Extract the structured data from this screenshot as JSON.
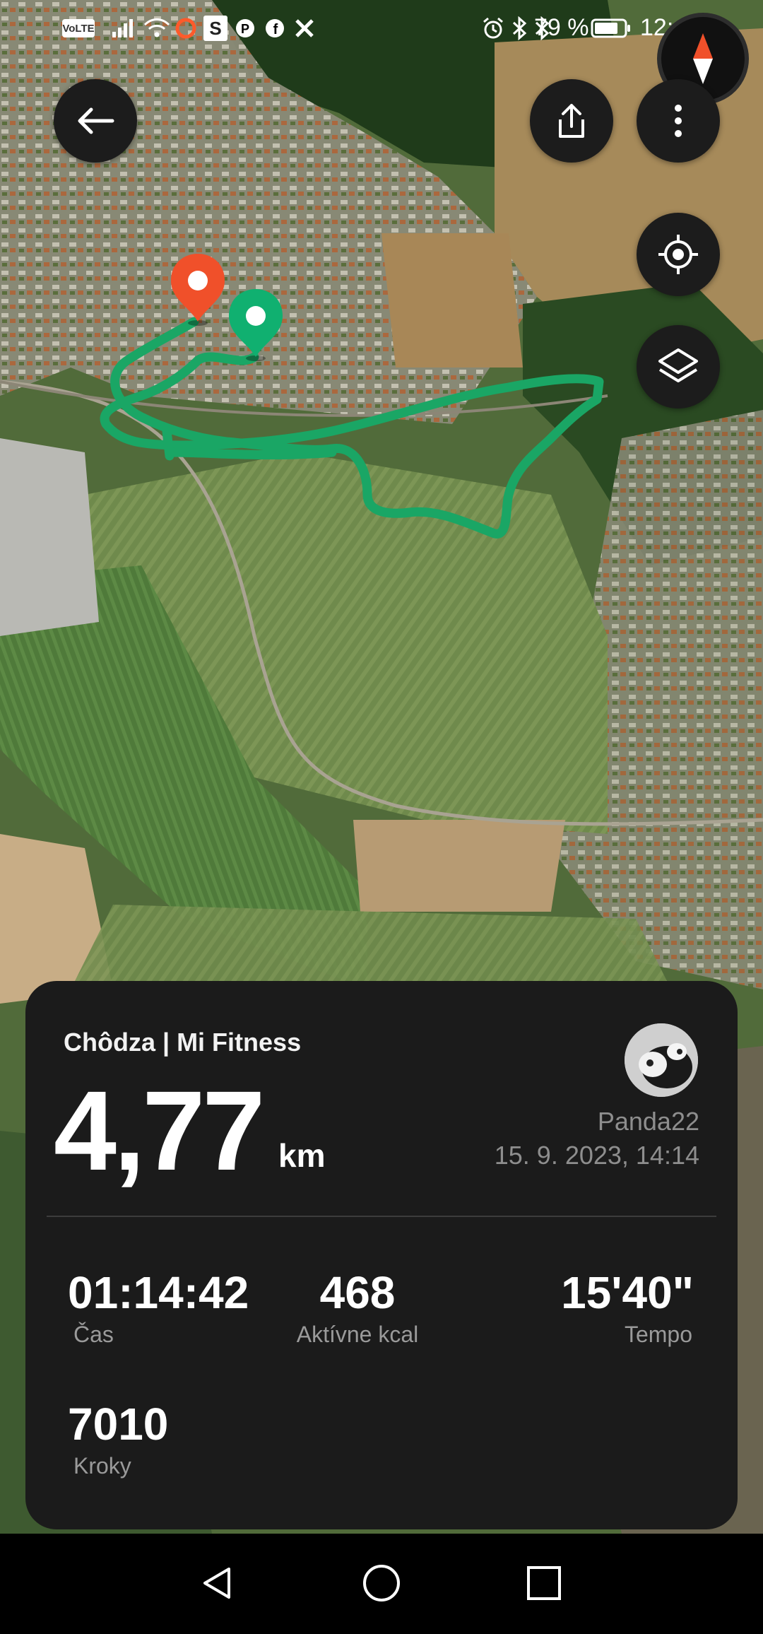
{
  "status_bar": {
    "volte": "VoLTE",
    "battery_text": "79 %",
    "time": "12:43",
    "icons": [
      "volte-icon",
      "signal-icon",
      "wifi-icon",
      "record-icon",
      "s-app-icon",
      "pinterest-icon",
      "facebook-icon",
      "x-icon",
      "alarm-icon",
      "vibrate-icon",
      "bluetooth-icon",
      "battery-icon"
    ]
  },
  "map": {
    "type": "satellite",
    "start_marker_color": "#10b070",
    "end_marker_color": "#f0502a",
    "route_color": "#1aa665"
  },
  "toolbar": {
    "icons": [
      "back-arrow-icon",
      "share-icon",
      "more-vert-icon",
      "my-location-icon",
      "layers-icon",
      "compass-icon"
    ]
  },
  "workout": {
    "title": "Chôdza | Mi Fitness",
    "distance": "4,77",
    "distance_unit": "km",
    "user": "Panda22",
    "date": "15. 9. 2023, 14:14",
    "stats": [
      {
        "value": "01:14:42",
        "label": "Čas"
      },
      {
        "value": "468",
        "label": "Aktívne kcal"
      },
      {
        "value": "15'40\"",
        "label": "Tempo"
      },
      {
        "value": "7010",
        "label": "Kroky"
      }
    ]
  },
  "nav_bar": {
    "icons": [
      "back-triangle-icon",
      "home-circle-icon",
      "recents-square-icon"
    ]
  }
}
